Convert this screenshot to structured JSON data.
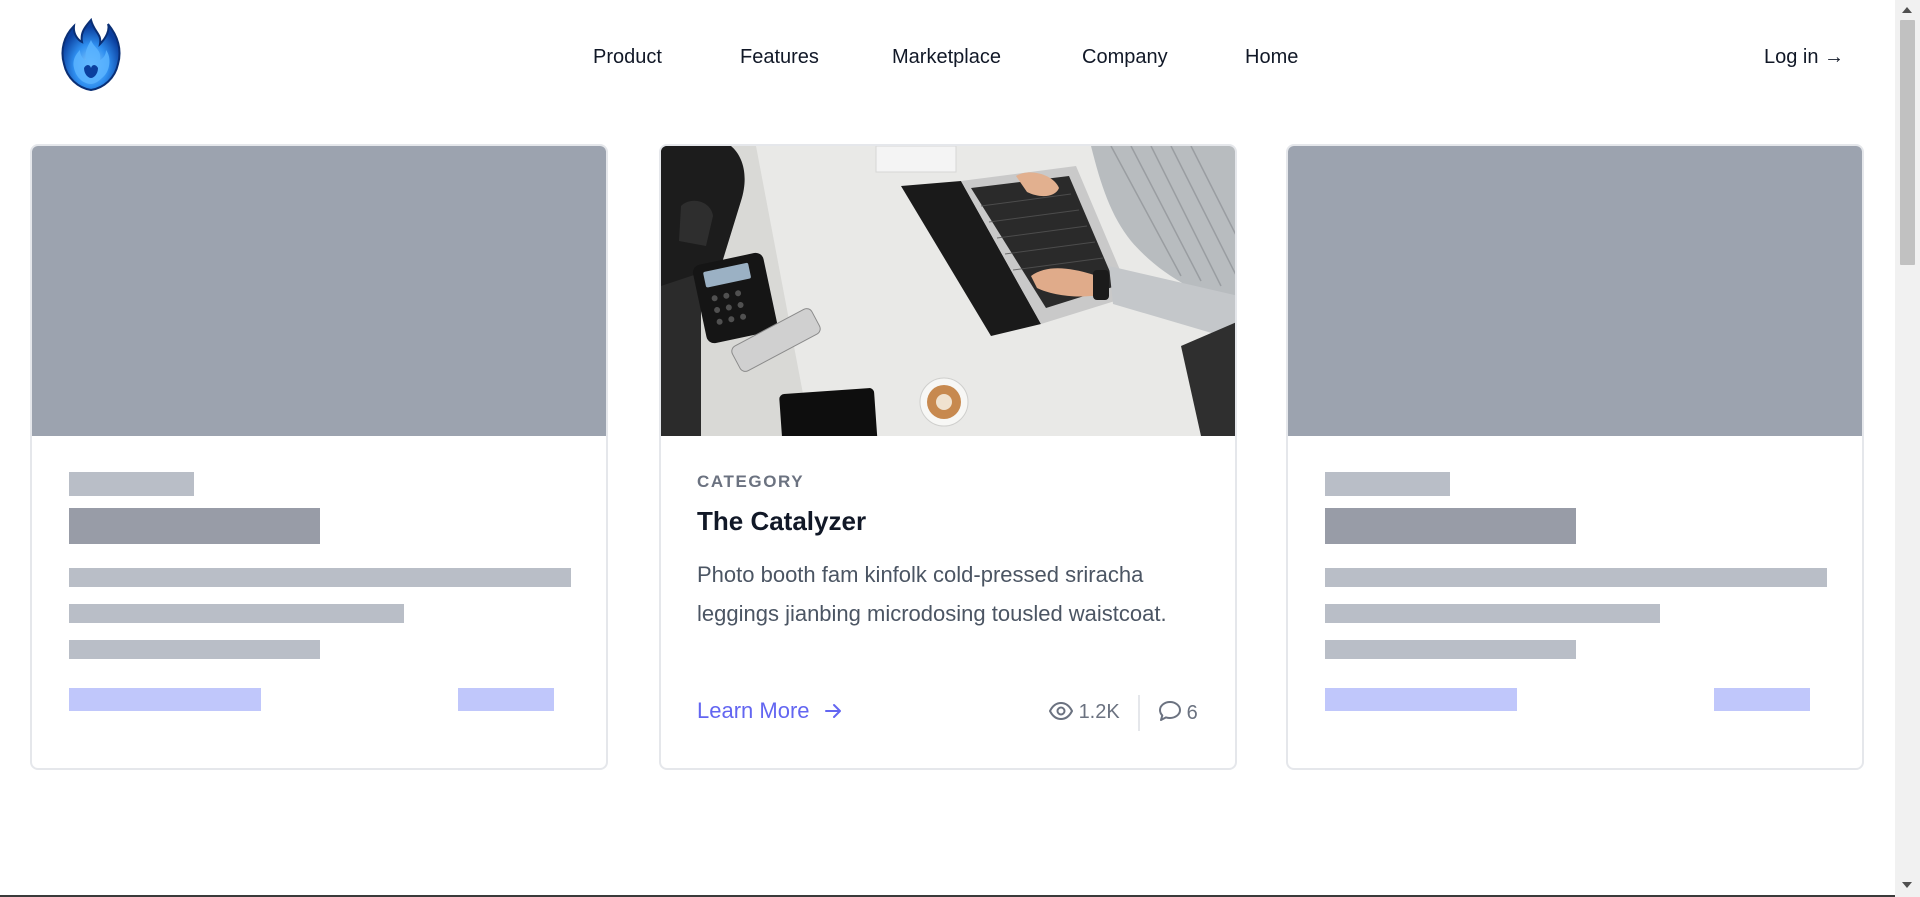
{
  "header": {
    "logo": {
      "icon": "blue-flame-logo-icon"
    },
    "nav": [
      {
        "label": "Product"
      },
      {
        "label": "Features"
      },
      {
        "label": "Marketplace"
      },
      {
        "label": "Company"
      },
      {
        "label": "Home"
      }
    ],
    "login_label": "Log in →"
  },
  "cards": {
    "featured": {
      "image_icon": "laptop-desk-photo",
      "category": "CATEGORY",
      "title": "The Catalyzer",
      "description": "Photo booth fam kinfolk cold-pressed sriracha leggings jianbing microdosing tousled waistcoat.",
      "learn_more": "Learn More",
      "learn_more_icon": "arrow-right-icon",
      "views": "1.2K",
      "views_icon": "eye-icon",
      "comments": "6",
      "comments_icon": "comment-icon"
    }
  },
  "colors": {
    "accent": "#6366f1",
    "skeleton_image": "#9ca3af",
    "skeleton_text": "#b9bec7",
    "skeleton_heading": "#989ca7",
    "skeleton_link": "#c0c7fb",
    "logo_blue": "#1d6fe0"
  }
}
